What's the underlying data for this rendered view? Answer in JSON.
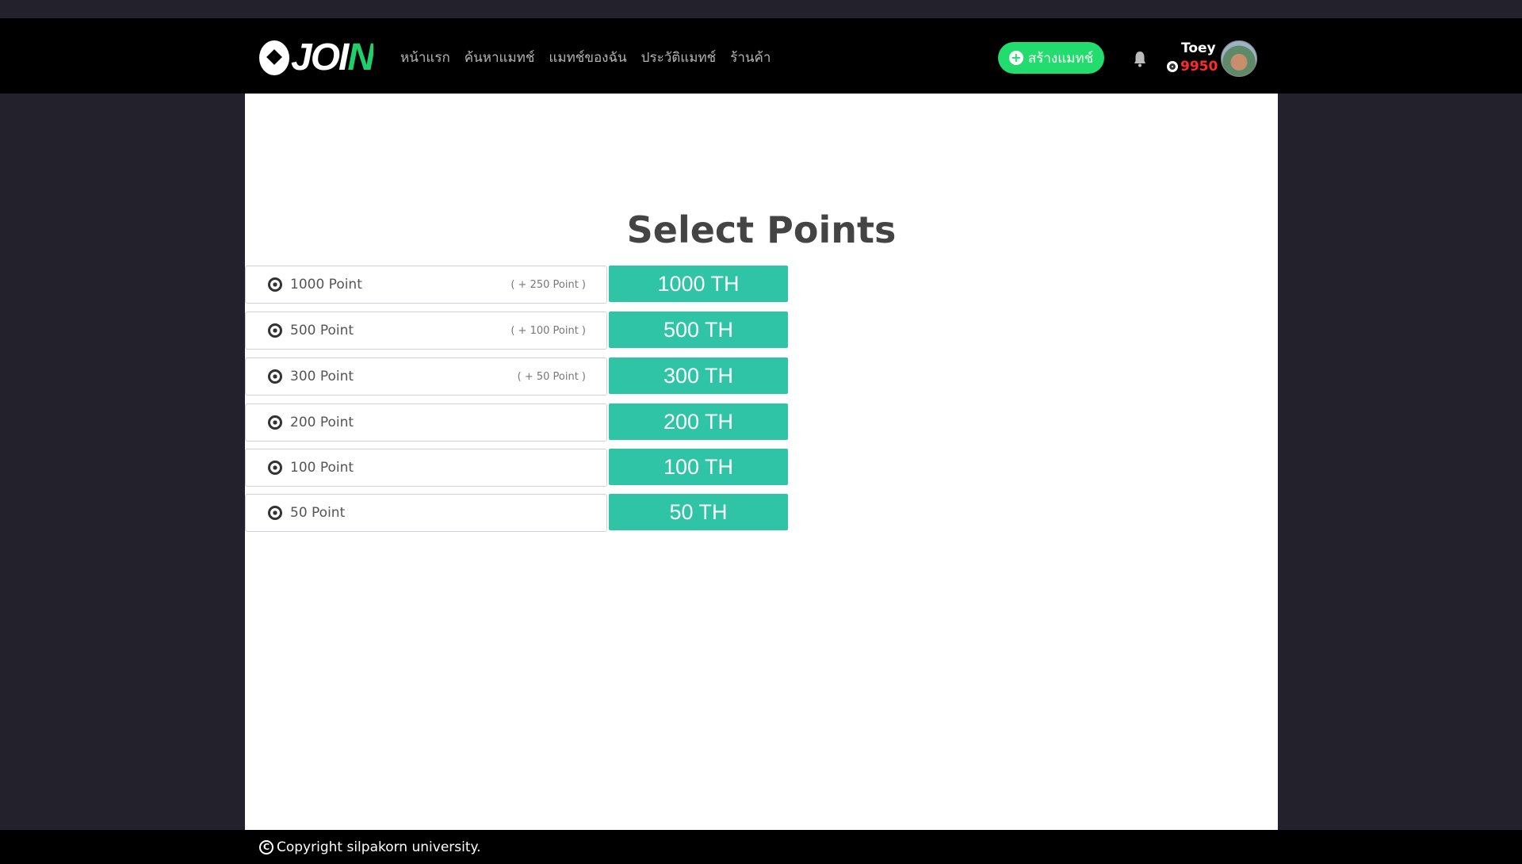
{
  "header": {
    "logo_text": "JOIN",
    "nav": [
      "หน้าแรก",
      "ค้นหาแมทช์",
      "แมทช์ของฉัน",
      "ประวัติแมทช์",
      "ร้านค้า"
    ],
    "create_button": "สร้างแมทช์",
    "user": {
      "name": "Toey",
      "points": "9950"
    }
  },
  "main": {
    "title": "Select Points",
    "packages": [
      {
        "label": "1000 Point",
        "bonus": "( + 250 Point )",
        "price": "1000 TH"
      },
      {
        "label": "500 Point",
        "bonus": "( + 100 Point )",
        "price": "500 TH"
      },
      {
        "label": "300 Point",
        "bonus": "( + 50 Point )",
        "price": "300 TH"
      },
      {
        "label": "200 Point",
        "bonus": "",
        "price": "200 TH"
      },
      {
        "label": "100 Point",
        "bonus": "",
        "price": "100 TH"
      },
      {
        "label": "50 Point",
        "bonus": "",
        "price": "50 TH"
      }
    ]
  },
  "footer": {
    "copyright": "Copyright silpakorn university."
  },
  "colors": {
    "accent": "#2ec4a5",
    "create": "#22dd6e",
    "points": "#ff2a2a"
  }
}
